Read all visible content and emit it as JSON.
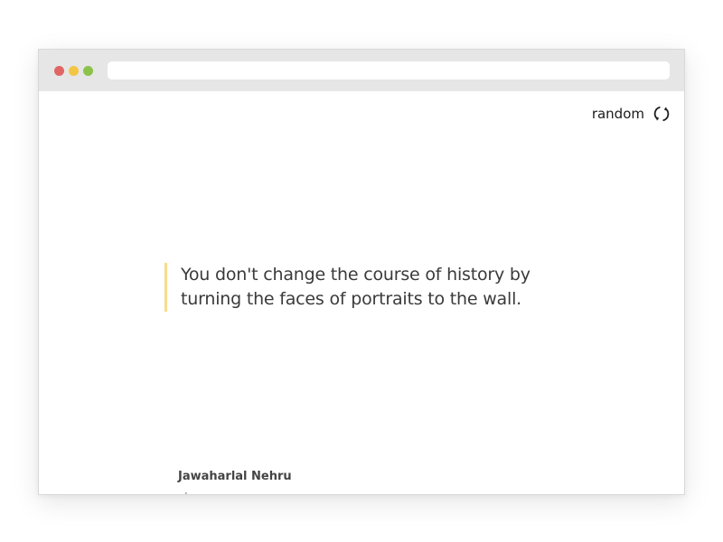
{
  "window": {
    "traffic_lights": [
      "#e06666",
      "#f4c542",
      "#8bc34a"
    ],
    "address_bar_value": ""
  },
  "toolbar": {
    "random_label": "random",
    "random_icon": "refresh-icon"
  },
  "quote": {
    "text": "You don't change the course of history by turning the faces of portraits to the wall.",
    "accent_color": "#f7dc8a"
  },
  "author": {
    "name": "Jawaharlal Nehru",
    "change_label": "change"
  }
}
